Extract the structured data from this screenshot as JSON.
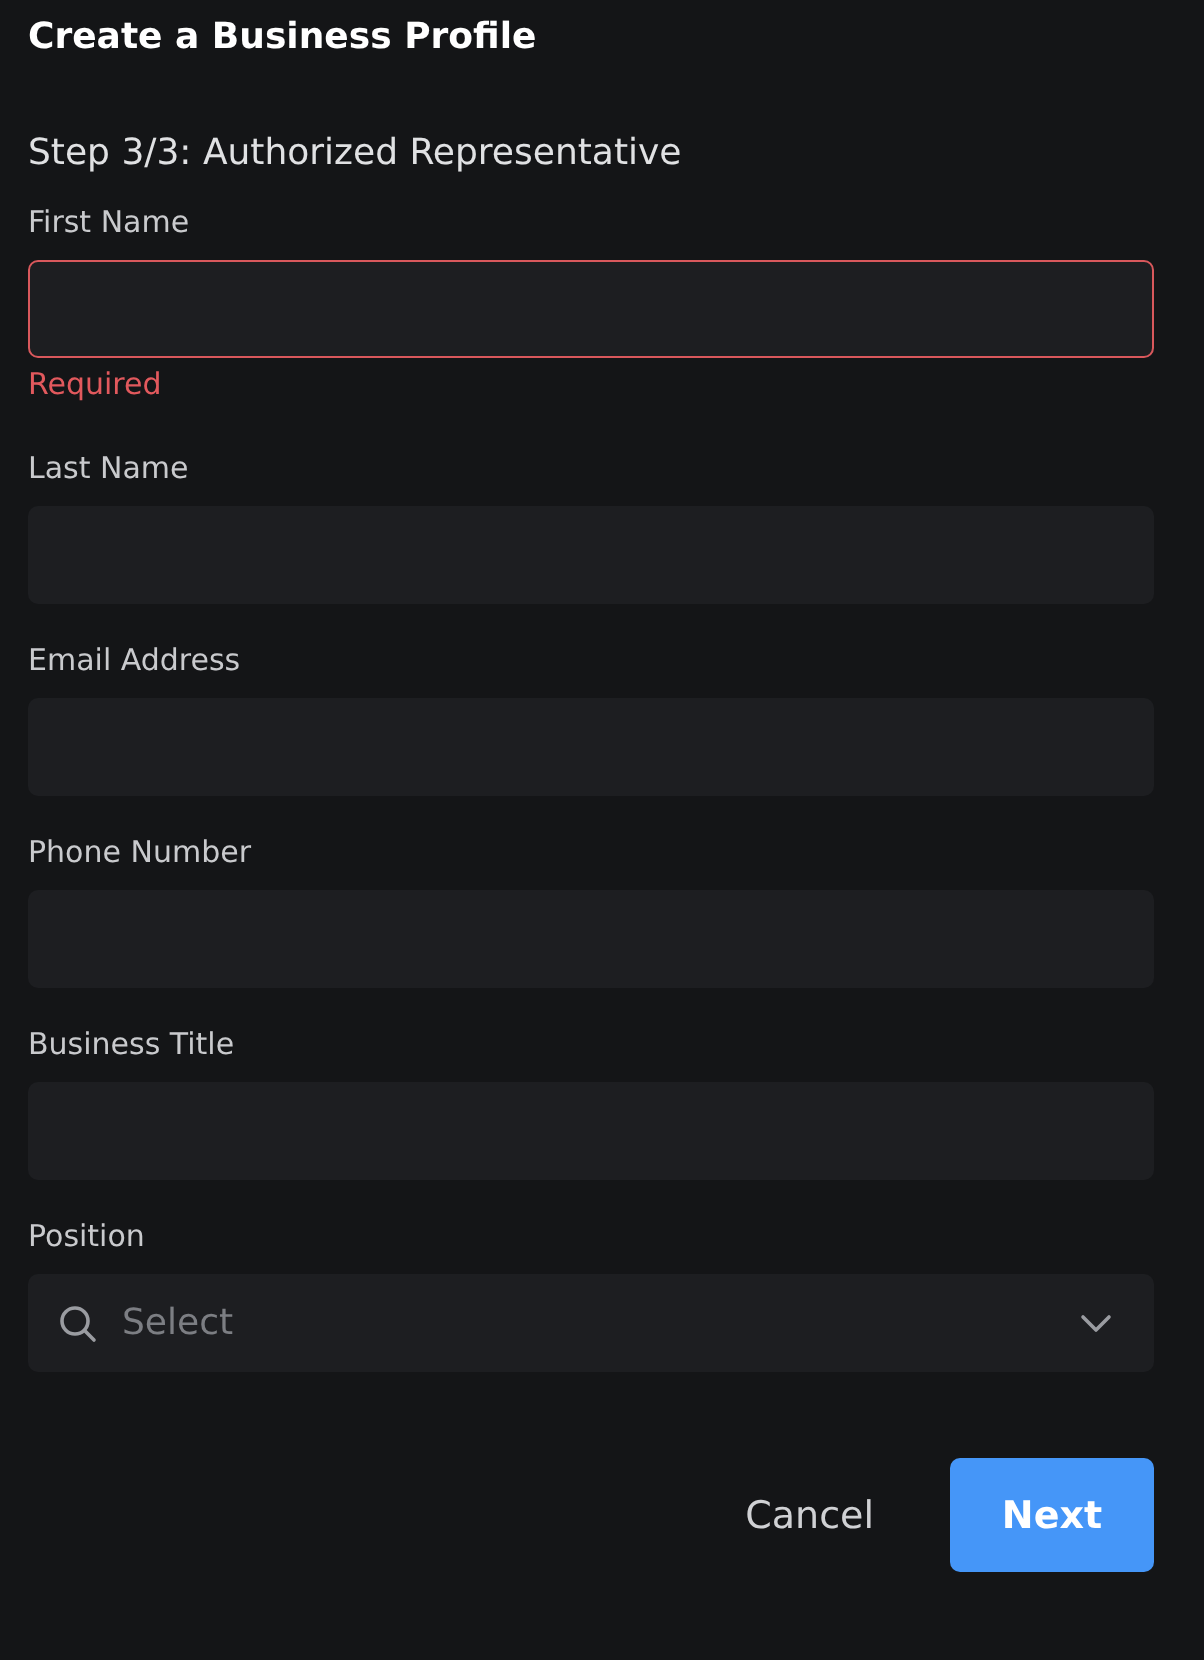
{
  "title": "Create a Business Profile",
  "step": "Step 3/3: Authorized Representative",
  "fields": [
    {
      "label": "First Name",
      "kind": "text",
      "invalid": true,
      "error": "Required"
    },
    {
      "label": "Last Name",
      "kind": "text",
      "invalid": false
    },
    {
      "label": "Email Address",
      "kind": "text",
      "invalid": false
    },
    {
      "label": "Phone Number",
      "kind": "text",
      "invalid": false
    },
    {
      "label": "Business Title",
      "kind": "text",
      "invalid": false
    },
    {
      "label": "Position",
      "kind": "select",
      "invalid": false,
      "placeholder": "Select"
    }
  ],
  "buttons": [
    {
      "label": "Cancel",
      "kind": "secondary"
    },
    {
      "label": "Next",
      "kind": "primary"
    }
  ]
}
